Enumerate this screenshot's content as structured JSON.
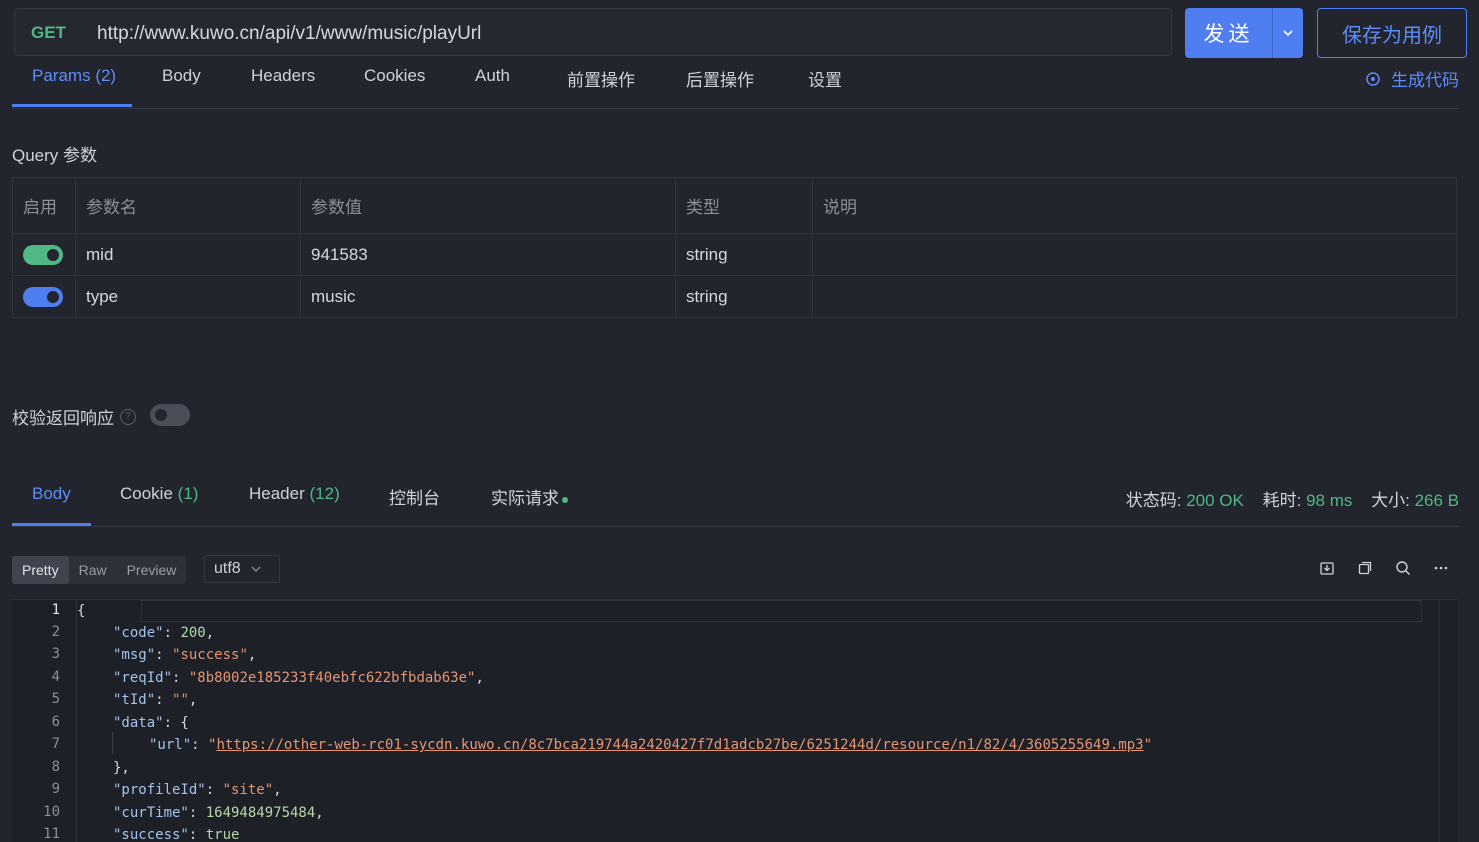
{
  "request": {
    "method": "GET",
    "url": "http://www.kuwo.cn/api/v1/www/music/playUrl",
    "send_label": "发送",
    "save_label": "保存为用例"
  },
  "req_tabs": {
    "params": "Params",
    "params_count": "(2)",
    "body": "Body",
    "headers": "Headers",
    "cookies": "Cookies",
    "auth": "Auth",
    "pre_ops": "前置操作",
    "post_ops": "后置操作",
    "settings": "设置",
    "gen_code": "生成代码"
  },
  "query": {
    "title": "Query 参数",
    "headers": [
      "启用",
      "参数名",
      "参数值",
      "类型",
      "说明"
    ],
    "rows": [
      {
        "name": "mid",
        "value": "941583",
        "type": "string",
        "desc": "",
        "toggle_color": "#4fb883"
      },
      {
        "name": "type",
        "value": "music",
        "type": "string",
        "desc": "",
        "toggle_color": "#4f7ef0"
      }
    ]
  },
  "verify_label": "校验返回响应",
  "resp_tabs": {
    "body": "Body",
    "cookie": "Cookie",
    "cookie_count": "(1)",
    "header": "Header",
    "header_count": "(12)",
    "console": "控制台",
    "actual": "实际请求"
  },
  "status": {
    "code_label": "状态码:",
    "code_value": "200 OK",
    "time_label": "耗时:",
    "time_value": "98 ms",
    "size_label": "大小:",
    "size_value": "266 B"
  },
  "view_modes": [
    "Pretty",
    "Raw",
    "Preview"
  ],
  "encoding": "utf8",
  "code_lines": {
    "numbers": [
      "1",
      "2",
      "3",
      "4",
      "5",
      "6",
      "7",
      "8",
      "9",
      "10",
      "11"
    ],
    "code_key": "\"code\"",
    "code_val": "200",
    "msg_key": "\"msg\"",
    "msg_val": "\"success\"",
    "reqId_key": "\"reqId\"",
    "reqId_val": "\"8b8002e185233f40ebfc622bfbdab63e\"",
    "tId_key": "\"tId\"",
    "tId_val": "\"\"",
    "data_key": "\"data\"",
    "url_key": "\"url\"",
    "url_val": "https://other-web-rc01-sycdn.kuwo.cn/8c7bca219744a2420427f7d1adcb27be/6251244d/resource/n1/82/4/3605255649.mp3",
    "profileId_key": "\"profileId\"",
    "profileId_val": "\"site\"",
    "curTime_key": "\"curTime\"",
    "curTime_val": "1649484975484",
    "success_key": "\"success\"",
    "success_val": "true"
  },
  "colors": {
    "accent": "#4f7ef0",
    "success": "#4fb883",
    "background": "#22252e"
  }
}
